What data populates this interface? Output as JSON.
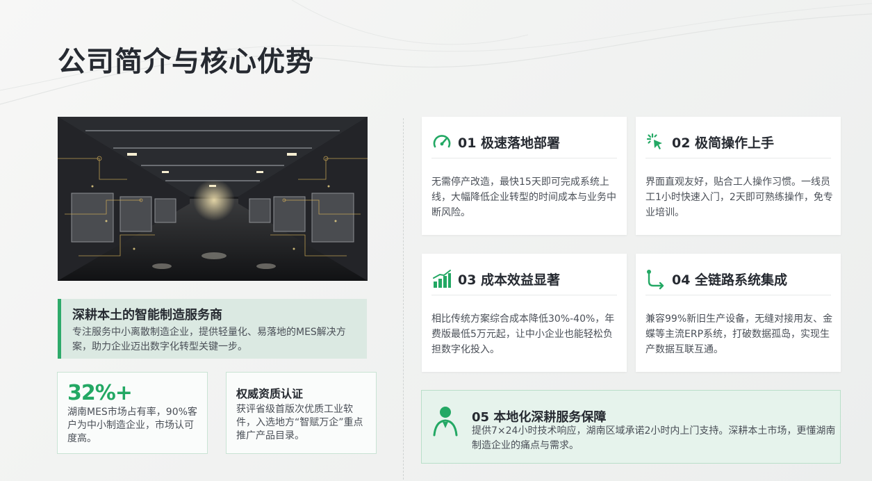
{
  "page": {
    "title": "公司简介与核心优势"
  },
  "intro": {
    "title": "深耕本土的智能制造服务商",
    "text": "专注服务中小离散制造企业，提供轻量化、易落地的MES解决方案，助力企业迈出数字化转型关键一步。"
  },
  "stats": [
    {
      "value": "32%+",
      "text": "湖南MES市场占有率，90%客户为中小制造企业，市场认可度高。"
    },
    {
      "title": "权威资质认证",
      "text": "获评省级首版次优质工业软件，入选地方“智赋万企”重点推广产品目录。"
    }
  ],
  "features": [
    {
      "title": "01 极速落地部署",
      "icon": "speedometer-icon",
      "text": "无需停产改造，最快15天即可完成系统上线，大幅降低企业转型的时间成本与业务中断风险。"
    },
    {
      "title": "02 极简操作上手",
      "icon": "cursor-click-icon",
      "text": "界面直观友好，贴合工人操作习惯。一线员工1小时快速入门，2天即可熟练操作，免专业培训。"
    },
    {
      "title": "03 成本效益显著",
      "icon": "bar-chart-icon",
      "text": "相比传统方案综合成本降低30%-40%，年费版最低5万元起，让中小企业也能轻松负担数字化投入。"
    },
    {
      "title": "04 全链路系统集成",
      "icon": "route-icon",
      "text": "兼容99%新旧生产设备，无缝对接用友、金蝶等主流ERP系统，打破数据孤岛，实现生产数据互联互通。"
    }
  ],
  "service": {
    "title": "05 本地化深耕服务保障",
    "icon": "support-person-icon",
    "text": "提供7×24小时技术响应，湖南区域承诺2小时内上门支持。深耕本土市场，更懂湖南制造企业的痛点与需求。"
  },
  "colors": {
    "accent": "#23a864",
    "intro_bg": "#dbe9e2",
    "service_bg": "#e6f3ec",
    "title": "#262a31"
  }
}
